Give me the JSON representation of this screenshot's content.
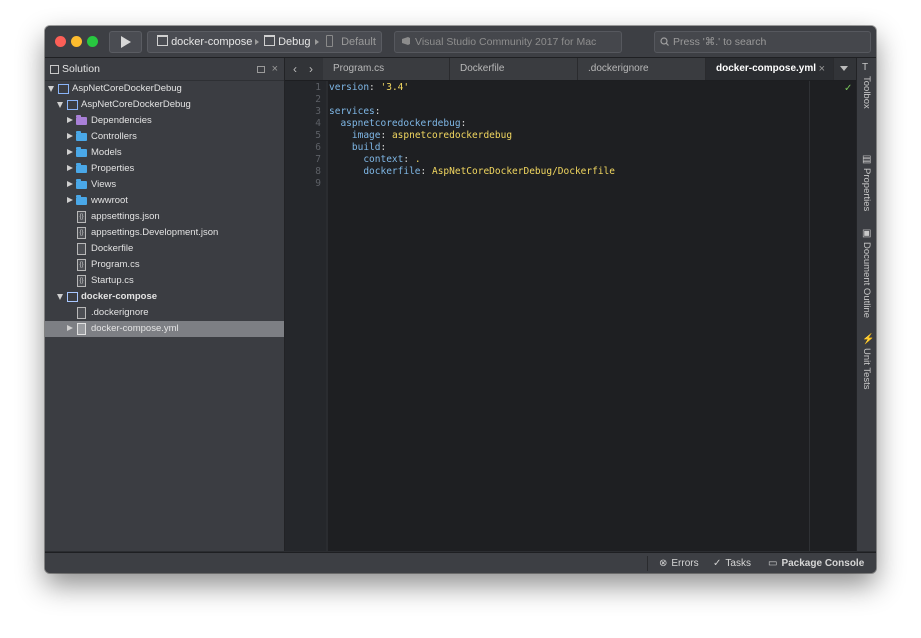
{
  "toolbar": {
    "config_project": "docker-compose",
    "config_mode": "Debug",
    "config_device": "Default",
    "status_text": "Visual Studio Community 2017 for Mac",
    "search_placeholder": "Press '⌘.' to search"
  },
  "solution_pad": {
    "title": "Solution",
    "close_glyph": "×",
    "items": [
      {
        "label": "AspNetCoreDockerDebug",
        "icon": "solution-icon"
      },
      {
        "label": "AspNetCoreDockerDebug",
        "icon": "project-icon"
      },
      {
        "label": "Dependencies",
        "icon": "dependencies-folder-icon"
      },
      {
        "label": "Controllers",
        "icon": "folder-icon"
      },
      {
        "label": "Models",
        "icon": "folder-icon"
      },
      {
        "label": "Properties",
        "icon": "folder-icon"
      },
      {
        "label": "Views",
        "icon": "folder-icon"
      },
      {
        "label": "wwwroot",
        "icon": "folder-icon"
      },
      {
        "label": "appsettings.json",
        "icon": "json-file-icon"
      },
      {
        "label": "appsettings.Development.json",
        "icon": "json-file-icon"
      },
      {
        "label": "Dockerfile",
        "icon": "file-icon"
      },
      {
        "label": "Program.cs",
        "icon": "cs-file-icon"
      },
      {
        "label": "Startup.cs",
        "icon": "cs-file-icon"
      },
      {
        "label": "docker-compose",
        "icon": "project-icon"
      },
      {
        "label": ".dockerignore",
        "icon": "file-icon"
      },
      {
        "label": "docker-compose.yml",
        "icon": "file-icon"
      }
    ]
  },
  "tabs": [
    {
      "label": "Program.cs"
    },
    {
      "label": "Dockerfile"
    },
    {
      "label": ".dockerignore"
    },
    {
      "label": "docker-compose.yml",
      "close": "×"
    }
  ],
  "editor": {
    "lines": [
      {
        "n": "1",
        "key": "version",
        "sep": ": ",
        "val": "'3.4'"
      },
      {
        "n": "2",
        "key": "",
        "sep": "",
        "val": ""
      },
      {
        "n": "3",
        "key": "services",
        "sep": ":",
        "val": ""
      },
      {
        "n": "4",
        "key": "  aspnetcoredockerdebug",
        "sep": ":",
        "val": ""
      },
      {
        "n": "5",
        "key": "    image",
        "sep": ": ",
        "val": "aspnetcoredockerdebug"
      },
      {
        "n": "6",
        "key": "    build",
        "sep": ":",
        "val": ""
      },
      {
        "n": "7",
        "key": "      context",
        "sep": ": ",
        "val": "."
      },
      {
        "n": "8",
        "key": "      dockerfile",
        "sep": ": ",
        "val": "AspNetCoreDockerDebug/Dockerfile"
      },
      {
        "n": "9",
        "key": "",
        "sep": "",
        "val": ""
      }
    ],
    "check": "✓"
  },
  "right_pads": [
    {
      "label": "Toolbox",
      "icon": "T"
    },
    {
      "label": "Properties",
      "icon": "▤"
    },
    {
      "label": "Document Outline",
      "icon": "▣"
    },
    {
      "label": "Unit Tests",
      "icon": "⚡"
    }
  ],
  "statusbar": {
    "errors": "Errors",
    "tasks": "Tasks",
    "package_console": "Package Console"
  }
}
